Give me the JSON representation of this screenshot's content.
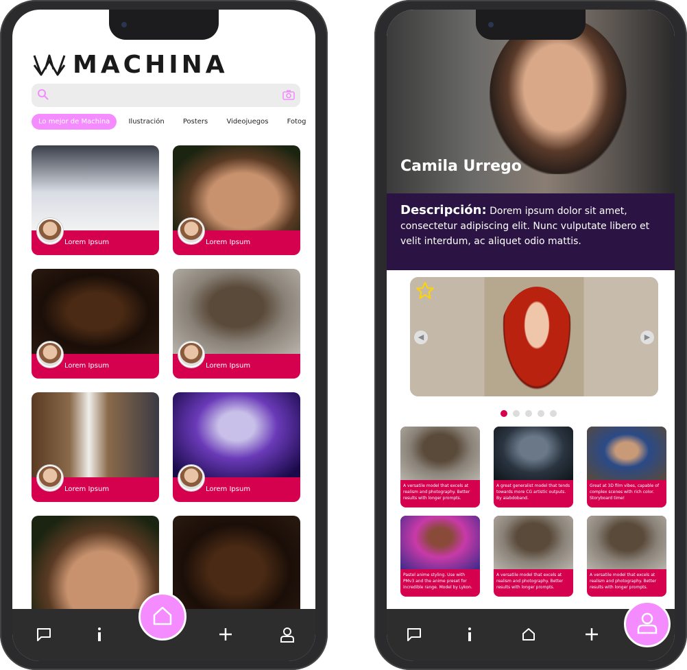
{
  "screen1": {
    "brand": "MACHINA",
    "search": {
      "placeholder": ""
    },
    "categories": [
      "Lo mejor de Machina",
      "Ilustración",
      "Posters",
      "Videojuegos",
      "Fotogr"
    ],
    "cards": [
      {
        "label": "Lorem Ipsum"
      },
      {
        "label": "Lorem Ipsum"
      },
      {
        "label": "Lorem Ipsum"
      },
      {
        "label": "Lorem Ipsum"
      },
      {
        "label": "Lorem Ipsum"
      },
      {
        "label": "Lorem Ipsum"
      },
      {
        "label": ""
      },
      {
        "label": ""
      }
    ],
    "nav": {
      "chat": "chat-icon",
      "info": "info-icon",
      "home": "home-icon",
      "add": "plus-icon",
      "profile": "user-icon"
    }
  },
  "screen2": {
    "profile_name": "Camila Urrego",
    "description_label": "Descripción:",
    "description_text": "Dorem ipsum dolor sit amet, consectetur adipiscing elit. Nunc vulputate libero et velit interdum, ac aliquet odio mattis.",
    "carousel": {
      "favorite": "star-icon",
      "dots": 5,
      "active_dot": 0
    },
    "models": [
      {
        "text": "A versatile model that excels at realism and photography. Better results with longer prompts."
      },
      {
        "text": "A great generalist model that tends towards more CG artistic outputs. By aiabdoband."
      },
      {
        "text": "Great at 3D film vibes, capable of complex scenes with rich color. Storyboard time!"
      },
      {
        "text": "Pastel anime styling. Use with PMv3 and the anime preset for incredible range. Model by Lykon."
      },
      {
        "text": "A versatile model that excels at realism and photography. Better results with longer prompts."
      },
      {
        "text": "A versatile model that excels at realism and photography. Better results with longer prompts."
      }
    ],
    "nav": {
      "chat": "chat-icon",
      "info": "info-icon",
      "home": "home-icon",
      "add": "plus-icon",
      "profile": "user-icon"
    }
  },
  "colors": {
    "accent": "#f48cff",
    "primary": "#d5004e",
    "description_bg": "#2b1444",
    "nav_bg": "#2d2d2d"
  }
}
